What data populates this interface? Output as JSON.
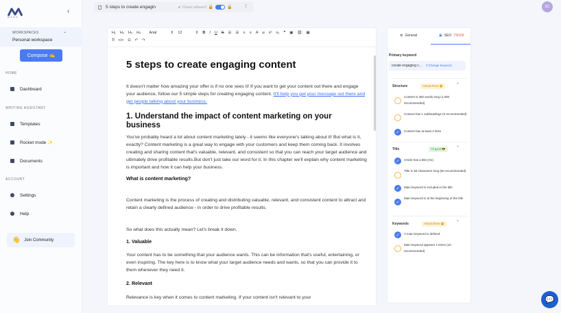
{
  "sidebar": {
    "logo_text": "MARK",
    "workspace_label": "WORKSPACES",
    "workspace_name": "Personal workspace",
    "compose_label": "Compose ✍️",
    "sections": {
      "home": "HOME",
      "writing": "WRITING ASSISTANT",
      "account": "ACCOUNT"
    },
    "items": [
      {
        "label": "Dashboard"
      },
      {
        "label": "Templates"
      },
      {
        "label": "Rocket mode ✨"
      },
      {
        "label": "Documents"
      },
      {
        "label": "Settings"
      },
      {
        "label": "Help"
      }
    ],
    "join": "Join Community"
  },
  "topbar": {
    "doc_title": "5 steps to create engagin",
    "saved_text": "Draser wibased",
    "avatar_initials": "SC"
  },
  "toolbar": {
    "font": "Arial",
    "size": "12",
    "headings": [
      "H₁",
      "H₂",
      "H₃",
      "H₄"
    ]
  },
  "doc": {
    "title": "5 steps to create engaging content",
    "intro": "It doesn't matter how amazing your offer is if no one sees it! If you want to get your content out there and engage your audience, follow our 5 simple steps for creating engaging content. ",
    "intro_link": "It'll help you get your message out there and get people talking about your business.",
    "h2_1": "1. Understand the impact of content marketing on your business",
    "p1": "You've probably heard a lot about content marketing lately - it seems like everyone's talking about it! But what is it, exactly? Content marketing is a great way to engage with your customers and keep them coming back. It involves creating and sharing content that's valuable, relevant, and consistent so that you can reach your target audience and ultimately drive profitable results.But don't just take our word for it. In this chapter we'll explain why content marketing is important and how it can help your business.",
    "h3_1": "What is content marketing?",
    "p2": "Content marketing is the process of creating and distributing valuable, relevant, and consistent content to attract and retain a clearly defined audience - in order to drive profitable results.",
    "p3": "So what does this actually mean? Let's break it down.",
    "h3_2": "1. Valuable",
    "p4": "Your content has to be something that your audience wants. This can be information that's useful, entertaining, or even inspiring. The key here is to know what your target audience needs and wants, so that you can provide it to them whenever they need it.",
    "h3_3": "2. Relevant",
    "p5": "Relevance is key when it comes to content marketing. If your content isn't relevant to your"
  },
  "panel": {
    "tab_general": "General",
    "tab_seo": "SEO",
    "seo_score": "79/100",
    "primary_keyword_label": "Primary keyword",
    "primary_keyword": "create engaging c...",
    "change_keyword": "Change keyword",
    "sections": [
      {
        "title": "Structure",
        "badge": "Almost there 😊",
        "items": [
          {
            "text": "Content is 350 words long (1,000 recommended)",
            "done": false
          },
          {
            "text": "Content has 1 subheadings (3 recommended)",
            "done": false
          },
          {
            "text": "Content has at least 2 links",
            "done": true
          }
        ]
      },
      {
        "title": "Title",
        "badge": "All good 😎",
        "items": [
          {
            "text": "Article has a title (H1)",
            "done": true
          },
          {
            "text": "Title is 38 characters long (60 recommended)",
            "done": false
          },
          {
            "text": "Main keyword is included in the title",
            "done": true
          },
          {
            "text": "Main keyword is at the beginning of the title",
            "done": true
          }
        ]
      },
      {
        "title": "Keywords",
        "badge": "Almost there 😊",
        "items": [
          {
            "text": "A main keyword is defined",
            "done": true
          },
          {
            "text": "Main keyword appears 1 times (10 recommended)",
            "done": false
          }
        ]
      }
    ]
  },
  "colors": {
    "accent": "#4a7bf0",
    "warn": "#f0b54a",
    "good": "#2f9a46",
    "chat": "#1e5fcf"
  }
}
